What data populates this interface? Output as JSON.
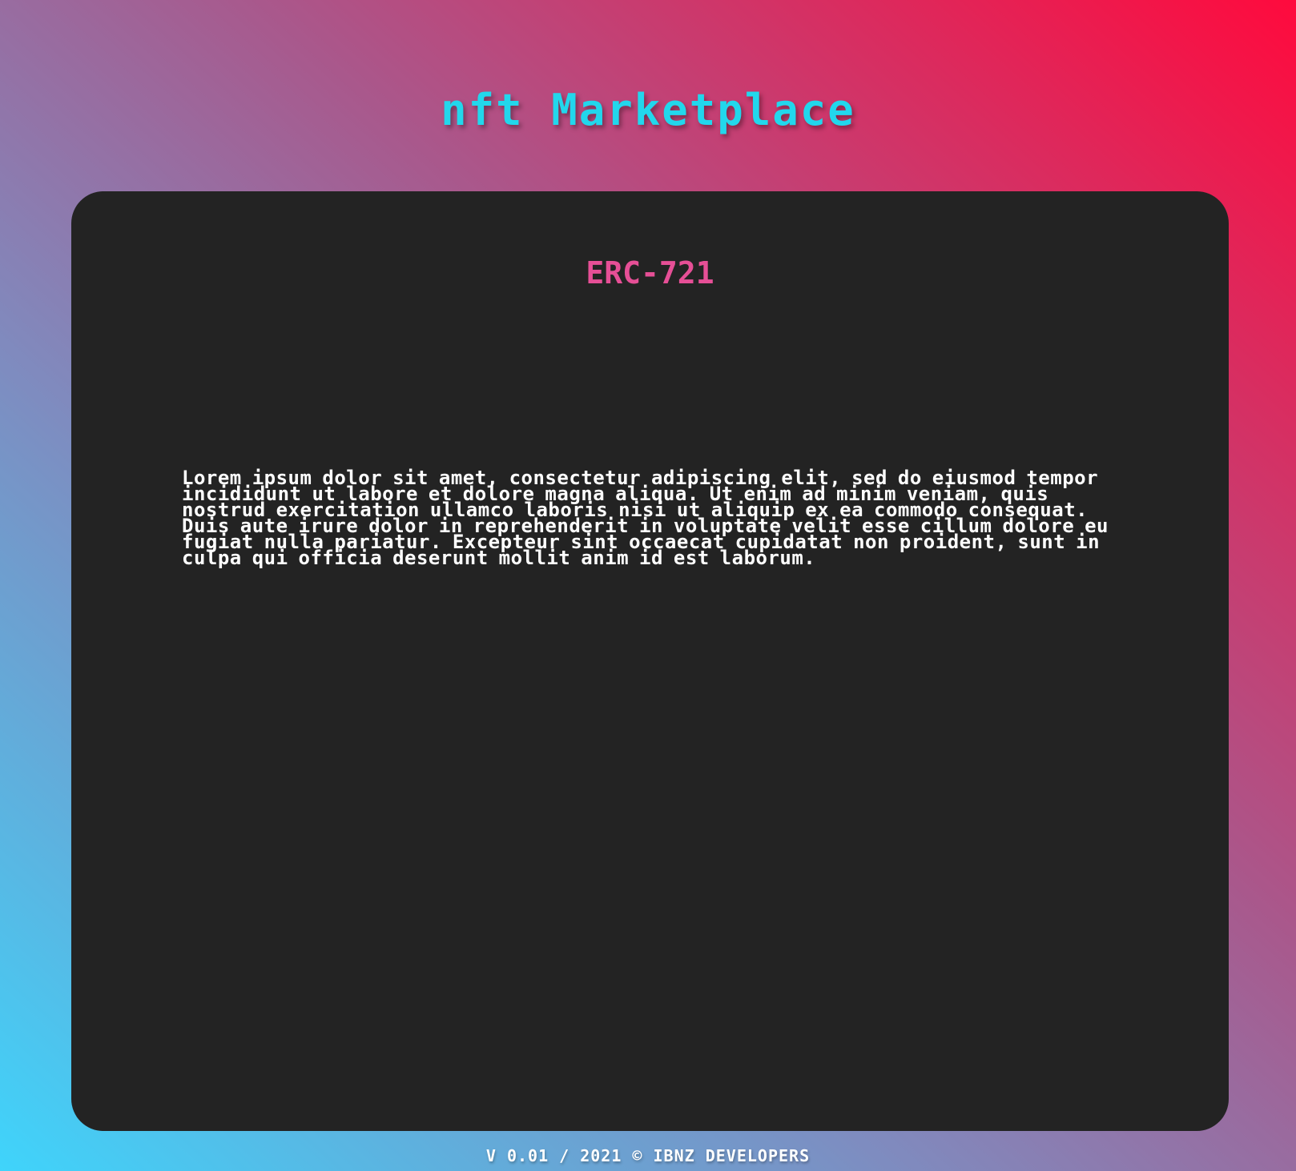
{
  "header": {
    "title": "nft Marketplace"
  },
  "card": {
    "title": "ERC-721",
    "body": "Lorem ipsum dolor sit amet, consectetur adipiscing elit, sed do eiusmod tempor incididunt ut labore et dolore magna aliqua. Ut enim ad minim veniam, quis nostrud exercitation ullamco laboris nisi ut aliquip ex ea commodo consequat. Duis aute irure dolor in reprehenderit in voluptate velit esse cillum dolore eu fugiat nulla pariatur. Excepteur sint occaecat cupidatat non proident, sunt in culpa qui officia deserunt mollit anim id est laborum."
  },
  "footer": {
    "text": "V 0.01 / 2021 © IBNZ DEVELOPERS"
  },
  "colors": {
    "title": "#22d7ec",
    "card_background": "#232323",
    "card_title": "#e64f96",
    "body_text": "#ffffff",
    "gradient_start": "#3fd4fb",
    "gradient_end": "#ff0a3d"
  }
}
